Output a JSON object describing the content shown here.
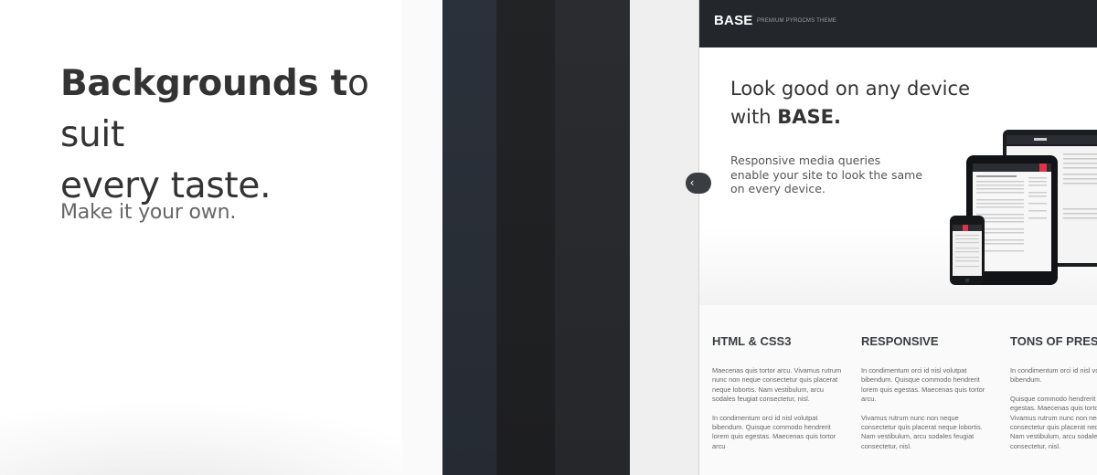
{
  "hero_left": {
    "headline_bold": "Backgrounds t",
    "headline_rest": "o suit",
    "headline_line2": "every taste.",
    "subline": "Make it your own."
  },
  "swatches": [
    "#2b313a",
    "#222325",
    "#2a2c2f",
    "#efefef"
  ],
  "preview": {
    "brand": "BASE",
    "tagline": "PREMIUM PYROCMS THEME",
    "hero_title_line1": "Look good on any device",
    "hero_title_line2_prefix": "with ",
    "hero_title_line2_bold": "BASE.",
    "hero_desc": "Responsive media queries enable your site to look the same on every device.",
    "features": [
      {
        "title": "HTML & CSS3",
        "p1": "Maecenas quis tortor arcu. Vivamus rutrum nunc non neque consectetur quis placerat neque lobortis. Nam vestibulum, arcu sodales feugiat consectetur, nisl.",
        "p2": "In condimentum orci id nisl volutpat bibendum. Quisque commodo hendrerit lorem quis egestas. Maecenas quis tortor arcu"
      },
      {
        "title": "RESPONSIVE",
        "p1": "In condimentum orci id nisl volutpat bibendum. Quisque commodo hendrerit lorem quis egestas. Maecenas quis tortor arcu.",
        "p2": "Vivamus rutrum nunc non neque consectetur quis placerat neque lobortis. Nam vestibulum, arcu sodales feugiat consectetur, nisl."
      },
      {
        "title": "TONS OF PRESETS",
        "p1": "In condimentum orci id nisl volutpat bibendum.",
        "p2": "Quisque commodo hendrerit lorem quis egestas. Maecenas quis tortor arcu. Vivamus rutrum nunc non neque consectetur quis placerat neque lobortis. Nam vestibulum, arcu sodales feugiat consectetur, nisl."
      }
    ]
  },
  "controls": {
    "collapse_icon": "chevron-left-icon"
  }
}
